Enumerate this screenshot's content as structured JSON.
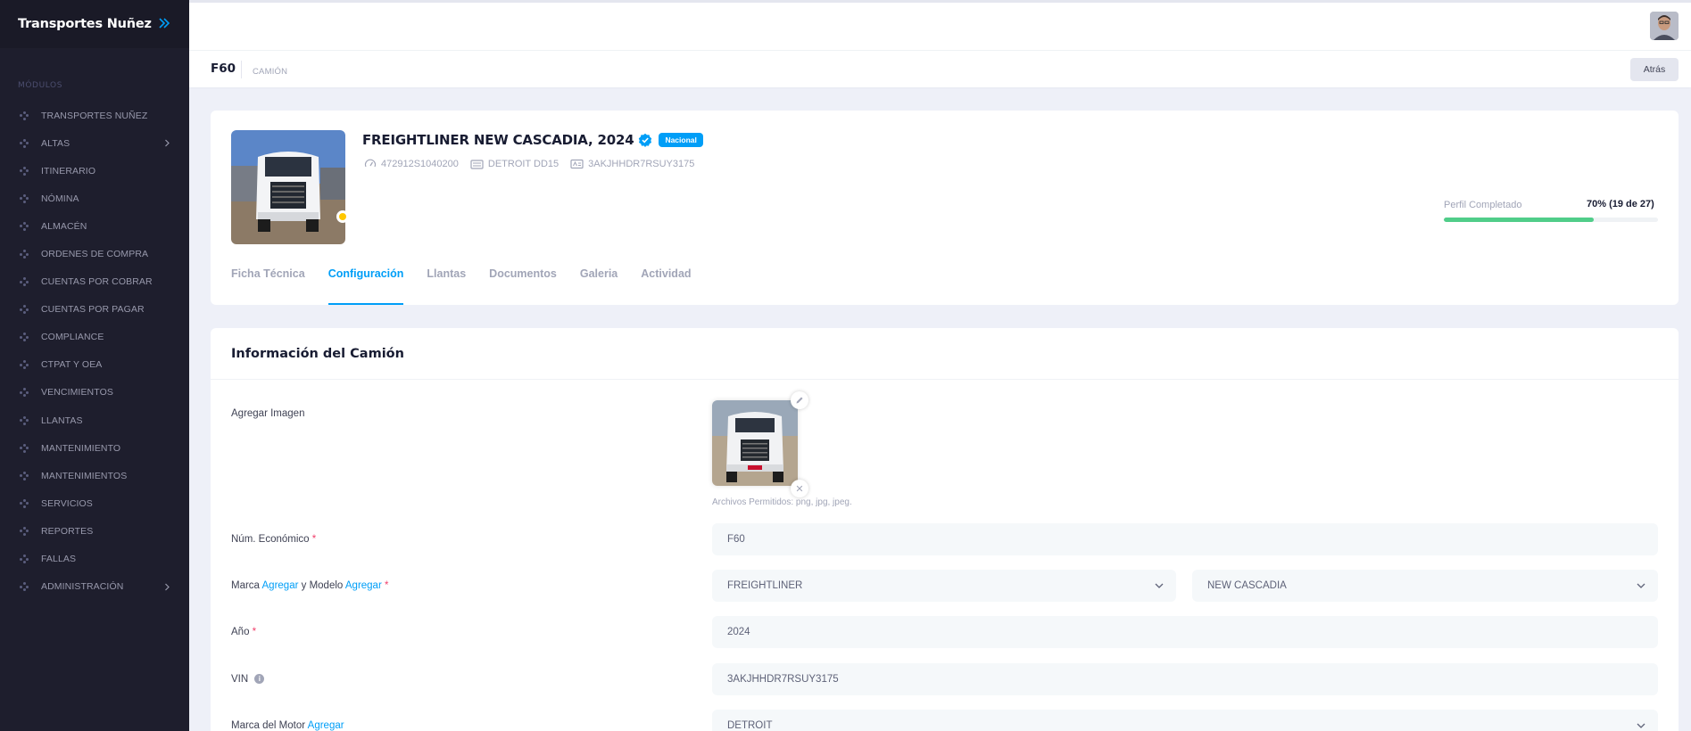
{
  "sidebar": {
    "brand": "Transportes Nuñez",
    "section_label": "MÓDULOS",
    "items": [
      {
        "label": "TRANSPORTES NUÑEZ",
        "arrow": false
      },
      {
        "label": "ALTAS",
        "arrow": true
      },
      {
        "label": "ITINERARIO",
        "arrow": false
      },
      {
        "label": "NÓMINA",
        "arrow": false
      },
      {
        "label": "ALMACÉN",
        "arrow": false
      },
      {
        "label": "ORDENES DE COMPRA",
        "arrow": false
      },
      {
        "label": "CUENTAS POR COBRAR",
        "arrow": false
      },
      {
        "label": "CUENTAS POR PAGAR",
        "arrow": false
      },
      {
        "label": "COMPLIANCE",
        "arrow": false
      },
      {
        "label": "CTPAT Y OEA",
        "arrow": false
      },
      {
        "label": "VENCIMIENTOS",
        "arrow": false
      },
      {
        "label": "LLANTAS",
        "arrow": false
      },
      {
        "label": "MANTENIMIENTO",
        "arrow": false
      },
      {
        "label": "MANTENIMIENTOS",
        "arrow": false
      },
      {
        "label": "SERVICIOS",
        "arrow": false
      },
      {
        "label": "REPORTES",
        "arrow": false
      },
      {
        "label": "FALLAS",
        "arrow": false
      },
      {
        "label": "ADMINISTRACIÓN",
        "arrow": true
      }
    ]
  },
  "toolbar": {
    "title": "F60",
    "subtitle": "CAMIÓN",
    "back_label": "Atrás"
  },
  "vehicle": {
    "title": "FREIGHTLINER NEW CASCADIA, 2024",
    "badge": "Nacional",
    "odometer": "472912S1040200",
    "engine": "DETROIT DD15",
    "vin": "3AKJHHDR7RSUY3175",
    "status_color": "#ffc700"
  },
  "profile": {
    "label": "Perfil Completado",
    "value_text": "70% (19 de 27)",
    "percent": 70
  },
  "tabs": [
    {
      "label": "Ficha Técnica",
      "active": false
    },
    {
      "label": "Configuración",
      "active": true
    },
    {
      "label": "Llantas",
      "active": false
    },
    {
      "label": "Documentos",
      "active": false
    },
    {
      "label": "Galeria",
      "active": false
    },
    {
      "label": "Actividad",
      "active": false
    }
  ],
  "form": {
    "title": "Información del Camión",
    "image_label": "Agregar Imagen",
    "allowed_files": "Archivos Permitidos: png, jpg, jpeg.",
    "remove_glyph": "✕",
    "num_eco_label": "Núm. Económico",
    "num_eco_value": "F60",
    "marca_label": "Marca",
    "agregar": "Agregar",
    "y_modelo": "y Modelo",
    "marca_value": "FREIGHTLINER",
    "modelo_value": "NEW CASCADIA",
    "anio_label": "Año",
    "anio_value": "2024",
    "vin_label": "VIN",
    "vin_value": "3AKJHHDR7RSUY3175",
    "motor_label": "Marca del Motor",
    "motor_value": "DETROIT",
    "required_mark": "*",
    "info_glyph": "i"
  },
  "colors": {
    "accent": "#009ef7",
    "success": "#50cd89",
    "danger": "#f1416c",
    "sidebar_bg": "#1e1e2d"
  }
}
